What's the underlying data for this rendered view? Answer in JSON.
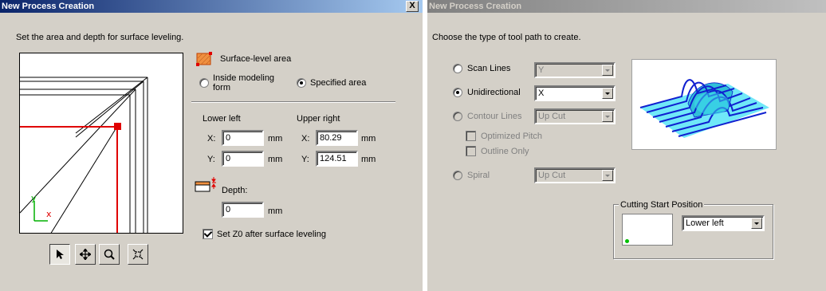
{
  "window1": {
    "title": "New Process Creation",
    "close_label": "X",
    "instruction": "Set the area and depth for surface leveling.",
    "surface_area_label": "Surface-level area",
    "radio_inside_label": "Inside modeling form",
    "radio_specified_label": "Specified area",
    "lower_left": {
      "heading": "Lower left",
      "x_label": "X:",
      "x_value": "0",
      "y_label": "Y:",
      "y_value": "0"
    },
    "upper_right": {
      "heading": "Upper right",
      "x_label": "X:",
      "x_value": "80.29",
      "y_label": "Y:",
      "y_value": "124.51"
    },
    "unit": "mm",
    "depth_label": "Depth:",
    "depth_value": "0",
    "set_z0_label": "Set Z0 after surface leveling",
    "axis_labels": {
      "y": "y",
      "x": "x"
    },
    "icons": [
      "select-arrow-icon",
      "pan-icon",
      "zoom-icon",
      "fit-view-icon"
    ]
  },
  "window2": {
    "title": "New Process Creation",
    "instruction": "Choose the type of tool path to create.",
    "scan_lines_label": "Scan Lines",
    "scan_lines_value": "Y",
    "unidirectional_label": "Unidirectional",
    "unidirectional_value": "X",
    "contour_lines_label": "Contour Lines",
    "contour_lines_value": "Up Cut",
    "optimized_pitch_label": "Optimized Pitch",
    "outline_only_label": "Outline Only",
    "spiral_label": "Spiral",
    "spiral_value": "Up Cut",
    "cutting_start_label": "Cutting Start Position",
    "cutting_start_value": "Lower left"
  },
  "colors": {
    "dialog_bg": "#d4d0c8",
    "active_title": "#0a246a",
    "area_red": "#e00000",
    "preview_cyan": "#40e0f0",
    "preview_blue": "#1020d0",
    "start_dot": "#00c000"
  }
}
